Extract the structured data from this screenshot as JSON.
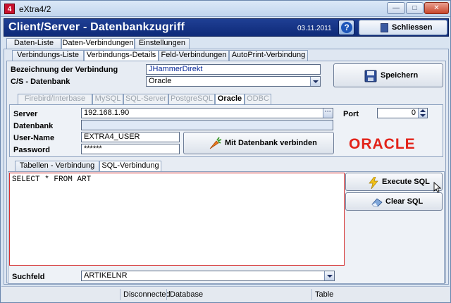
{
  "window": {
    "title": "eXtra4/2",
    "icon_letter": "4"
  },
  "header": {
    "title": "Client/Server - Datenbankzugriff",
    "date": "03.11.2011",
    "close_label": "Schliessen"
  },
  "top_tabs": [
    "Daten-Liste",
    "Daten-Verbindungen",
    "Einstellungen"
  ],
  "sub_tabs": [
    "Verbindungs-Liste",
    "Verbindungs-Details",
    "Feld-Verbindungen",
    "AutoPrint-Verbindung"
  ],
  "connection": {
    "name_label": "Bezeichnung der Verbindung",
    "name_value": "JHammerDirekt",
    "db_label": "C/S - Datenbank",
    "db_value": "Oracle",
    "save_label": "Speichern"
  },
  "db_tabs": [
    "Firebird/Interbase",
    "MySQL",
    "SQL-Server",
    "PostgreSQL",
    "Oracle",
    "ODBC"
  ],
  "server": {
    "server_label": "Server",
    "server_value": "192.168.1.90",
    "port_label": "Port",
    "port_value": "0",
    "database_label": "Datenbank",
    "database_value": "",
    "user_label": "User-Name",
    "user_value": "EXTRA4_USER",
    "password_label": "Password",
    "password_value": "******",
    "connect_label": "Mit Datenbank verbinden",
    "logo_text": "ORACLE"
  },
  "sql_tabs": [
    "Tabellen - Verbindung",
    "SQL-Verbindung"
  ],
  "sql": {
    "query": "SELECT * FROM ART",
    "execute_label": "Execute SQL",
    "clear_label": "Clear SQL",
    "search_label": "Suchfeld",
    "search_value": "ARTIKELNR"
  },
  "status": {
    "connection": "Disconnected",
    "database": "Database",
    "table": "Table"
  },
  "colors": {
    "banner": "#1f3f94",
    "logo": "#e2231a",
    "error_border": "#d63030"
  }
}
